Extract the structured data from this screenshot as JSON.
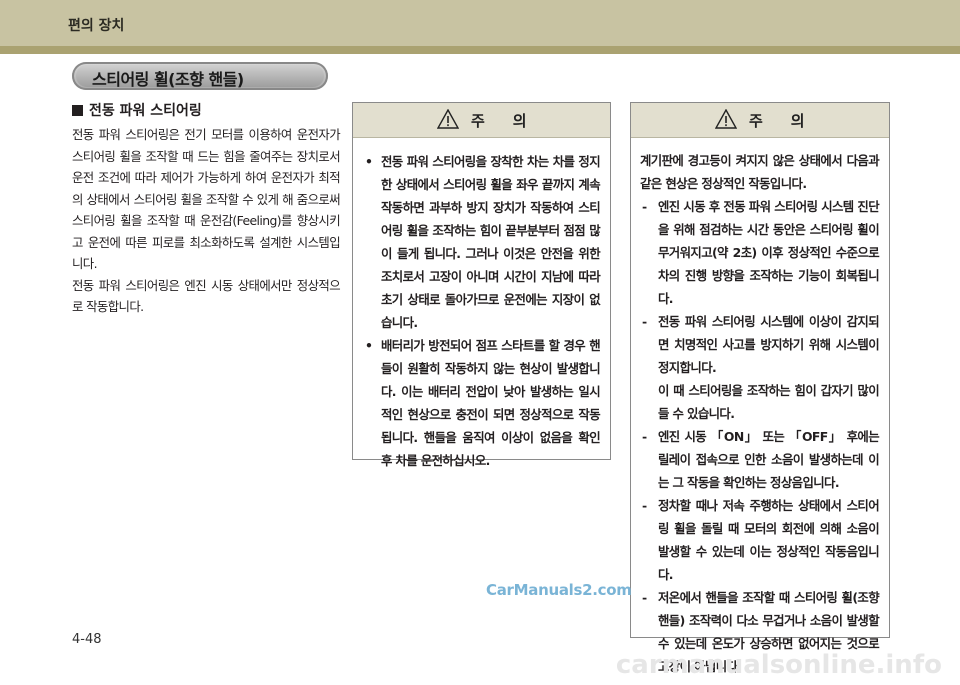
{
  "header": {
    "title": "편의 장치"
  },
  "section": {
    "title": "스티어링 휠(조향 핸들)"
  },
  "subsection": {
    "title": "전동 파워 스티어링"
  },
  "body": {
    "paragraphs": [
      "전동 파워 스티어링은 전기 모터를 이용하여 운전자가 스티어링 휠을 조작할 때 드는 힘을 줄여주는 장치로서 운전 조건에 따라 제어가 가능하게 하여 운전자가 최적의 상태에서 스티어링 휠을 조작할 수 있게 해 줌으로써 스티어링 휠을 조작할 때 운전감(Feeling)를 향상시키고 운전에 따른 피로를 최소화하도록 설계한 시스템입니다.",
      "전동 파워 스티어링은 엔진 시동 상태에서만 정상적으로 작동합니다."
    ]
  },
  "caution1": {
    "label": "주의",
    "items": [
      "전동 파워 스티어링을 장착한 차는 차를 정지한 상태에서 스티어링 휠을 좌우 끝까지 계속 작동하면 과부하 방지 장치가 작동하여 스티어링 휠을 조작하는 힘이 끝부분부터 점점 많이 들게 됩니다. 그러나 이것은 안전을 위한 조치로서 고장이 아니며 시간이 지남에 따라 초기 상태로 돌아가므로 운전에는 지장이 없습니다.",
      "배터리가 방전되어 점프 스타트를 할 경우 핸들이 원활히 작동하지 않는 현상이 발생합니다. 이는 배터리 전압이 낮아 발생하는 일시적인 현상으로 충전이 되면 정상적으로 작동됩니다. 핸들을 움직여 이상이 없음을 확인 후 차를 운전하십시오."
    ]
  },
  "caution2": {
    "label": "주의",
    "intro": "계기판에 경고등이 켜지지 않은 상태에서 다음과 같은 현상은 정상적인 작동입니다.",
    "items": [
      {
        "text": "엔진 시동 후 전동 파워 스티어링 시스템 진단을 위해 점검하는 시간 동안은 스티어링 휠이 무거워지고(약 2초) 이후 정상적인 수준으로 차의 진행 방향을 조작하는 기능이 회복됩니다."
      },
      {
        "text": "전동 파워 스티어링 시스템에 이상이 감지되면 치명적인 사고를 방지하기 위해 시스템이 정지합니다.",
        "note": "이 때 스티어링을 조작하는 힘이 갑자기 많이 들 수 있습니다."
      },
      {
        "text": "엔진 시동 「ON」 또는 「OFF」 후에는 릴레이 접속으로 인한 소음이 발생하는데 이는 그 작동을 확인하는 정상음입니다."
      },
      {
        "text": "정차할 때나 저속 주행하는 상태에서 스티어링 휠을 돌릴 때 모터의 회전에 의해 소음이 발생할 수 있는데 이는 정상적인 작동음입니다."
      },
      {
        "text": "저온에서 핸들을 조작할 때 스티어링 휠(조향 핸들) 조작력이 다소 무겁거나 소음이 발생할 수 있는데 온도가 상승하면 없어지는 것으로 고장이 아닙니다."
      }
    ]
  },
  "footer": {
    "page": "4-48"
  },
  "watermarks": {
    "site1": "CarManuals2.com",
    "site2": "carmanualsonline.info"
  },
  "colors": {
    "band": "#c8c3a2",
    "band_line": "#aaa271",
    "caution_head": "#e2dfcf"
  }
}
